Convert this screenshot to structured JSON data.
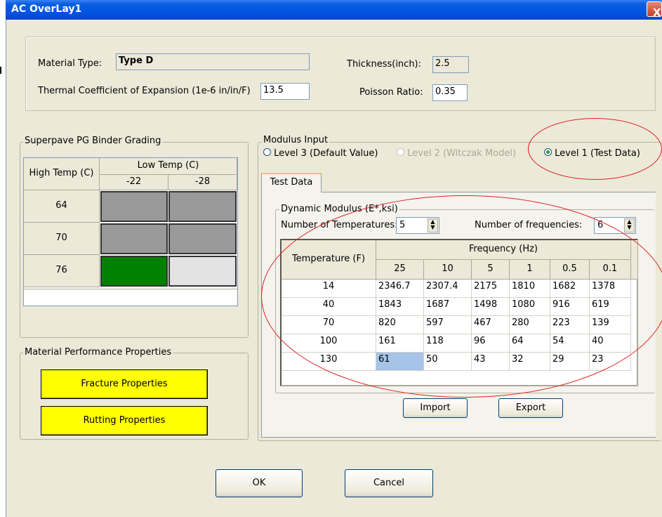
{
  "window": {
    "title": "AC OverLay1",
    "close_glyph": "X"
  },
  "material": {
    "type_label": "Material Type:",
    "type_value": "Type D",
    "thickness_label": "Thickness(inch):",
    "thickness_value": "2.5",
    "thermal_label": "Thermal Coefficient of Expansion (1e-6 in/in/F)",
    "thermal_value": "13.5",
    "poisson_label": "Poisson Ratio:",
    "poisson_value": "0.35"
  },
  "binder": {
    "title": "Superpave PG Binder Grading",
    "high_header": "High Temp (C)",
    "low_header": "Low Temp (C)",
    "low_temps": [
      "-22",
      "-28"
    ],
    "rows": [
      {
        "high": "64",
        "cells": [
          "grey",
          "grey"
        ]
      },
      {
        "high": "70",
        "cells": [
          "grey",
          "grey"
        ]
      },
      {
        "high": "76",
        "cells": [
          "green",
          "light"
        ]
      }
    ],
    "colors": {
      "grey": "#999999",
      "green": "#008000",
      "light": "#e3e3e3"
    }
  },
  "performance": {
    "title": "Material Performance Properties",
    "fracture_label": "Fracture Properties",
    "rutting_label": "Rutting Properties",
    "button_color": "#ffff00"
  },
  "modulus": {
    "title": "Modulus Input",
    "level3_label": "Level 3  (Default Value)",
    "level2_label": "Level 2  (Witczak Model)",
    "level1_label": "Level 1  (Test Data)",
    "selected": "Level 1",
    "tab_label": "Test Data",
    "dynamic_title": "Dynamic Modulus (E*,ksi)",
    "num_temps_label": "Number of Temperatures:",
    "num_temps_value": "5",
    "num_freq_label": "Number of frequencies:",
    "num_freq_value": "6",
    "temp_header": "Temperature (F)",
    "freq_header": "Frequency (Hz)",
    "frequencies": [
      "25",
      "10",
      "5",
      "1",
      "0.5",
      "0.1"
    ],
    "rows": [
      {
        "temp": "14",
        "values": [
          "2346.7",
          "2307.4",
          "2175",
          "1810",
          "1682",
          "1378"
        ]
      },
      {
        "temp": "40",
        "values": [
          "1843",
          "1687",
          "1498",
          "1080",
          "916",
          "619"
        ]
      },
      {
        "temp": "70",
        "values": [
          "820",
          "597",
          "467",
          "280",
          "223",
          "139"
        ]
      },
      {
        "temp": "100",
        "values": [
          "161",
          "118",
          "96",
          "64",
          "54",
          "40"
        ]
      },
      {
        "temp": "130",
        "values": [
          "61",
          "50",
          "43",
          "32",
          "29",
          "23"
        ]
      }
    ],
    "selected_cell_color": "#a6c3e8",
    "import_label": "Import",
    "export_label": "Export"
  },
  "footer": {
    "ok_label": "OK",
    "cancel_label": "Cancel"
  },
  "annotation_color": "#e02020"
}
